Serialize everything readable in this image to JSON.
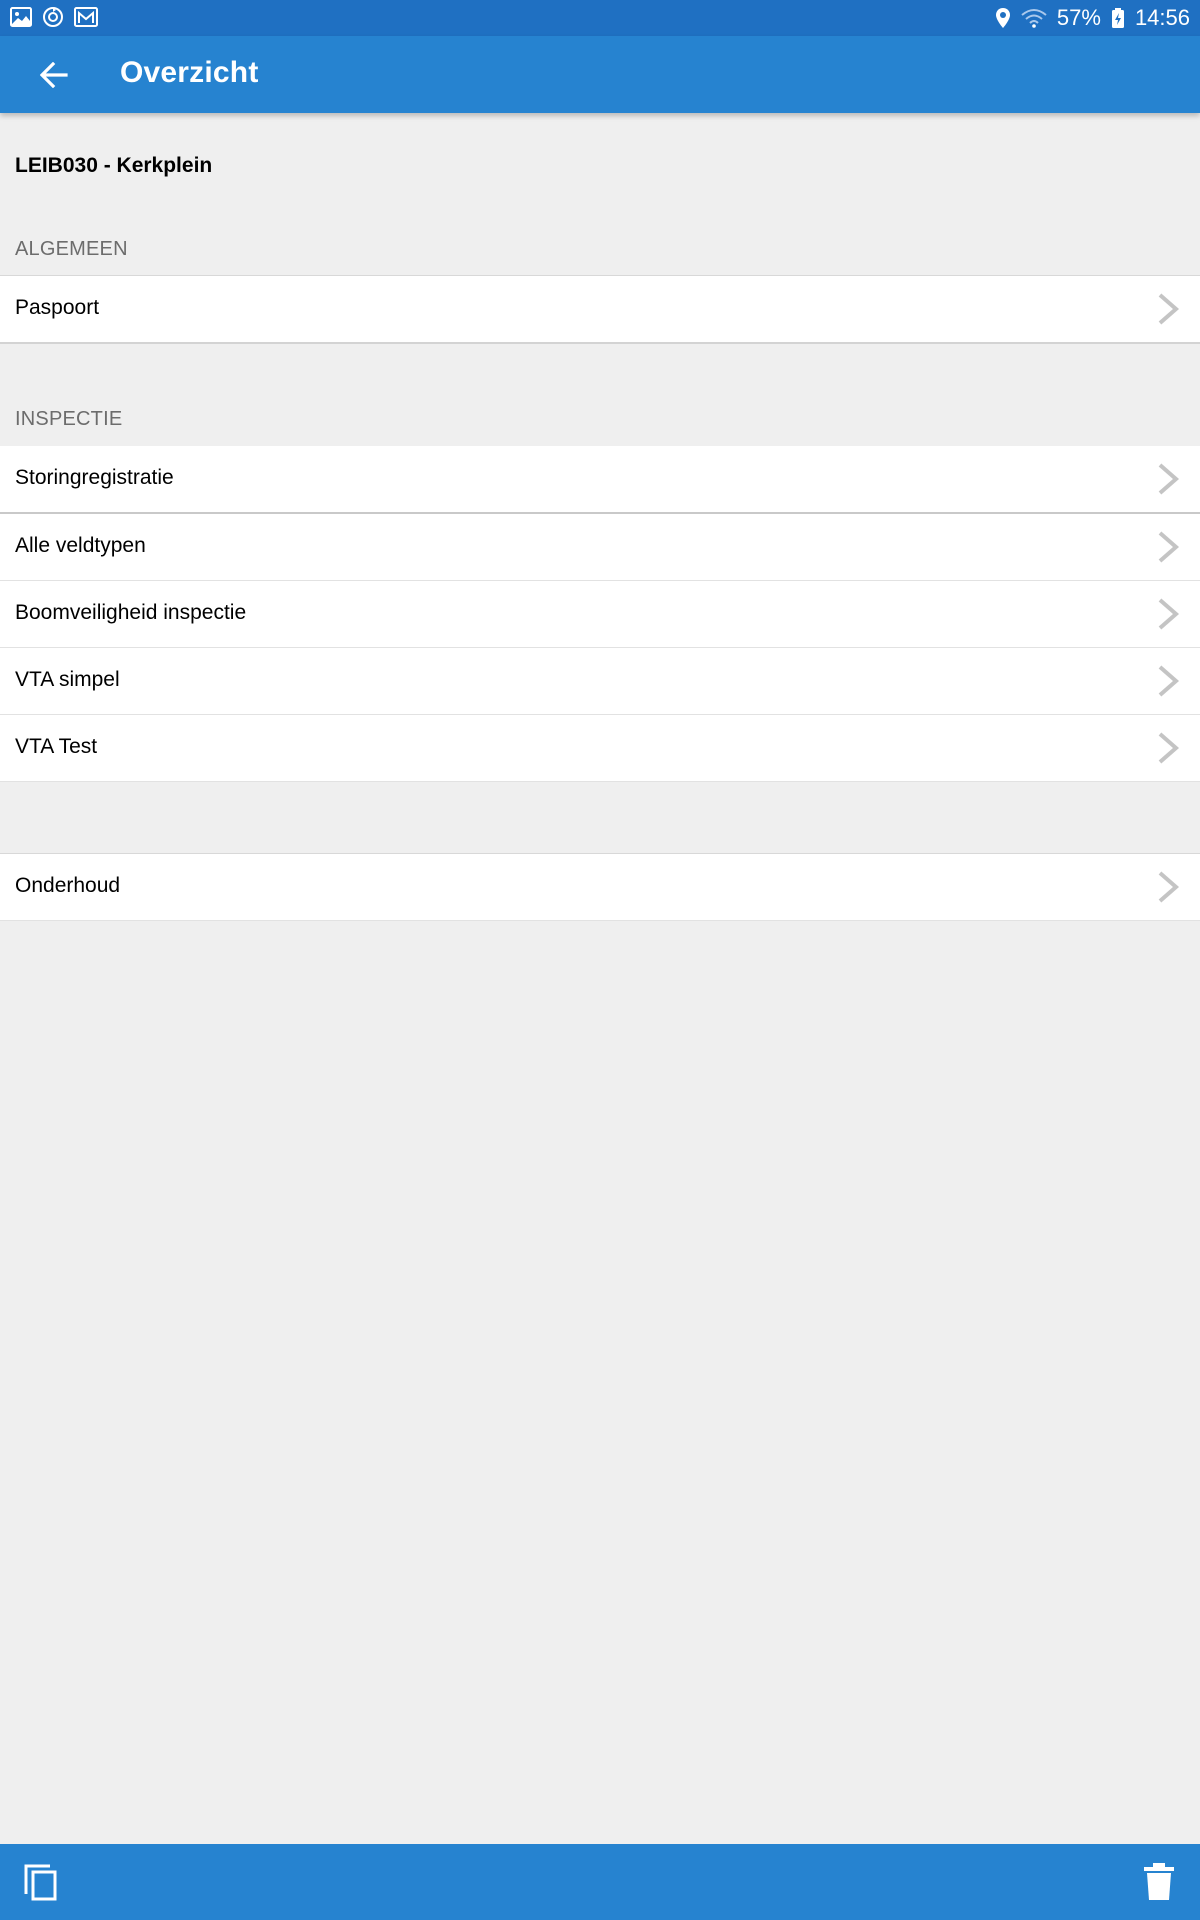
{
  "status_bar": {
    "battery": "57%",
    "time": "14:56"
  },
  "app_bar": {
    "title": "Overzicht"
  },
  "object": {
    "title": "LEIB030 - Kerkplein"
  },
  "sections": {
    "algemeen": {
      "header": "ALGEMEEN",
      "items": [
        "Paspoort"
      ]
    },
    "inspectie": {
      "header": "INSPECTIE",
      "items": [
        "Storingregistratie",
        "Alle veldtypen",
        "Boomveiligheid inspectie",
        "VTA simpel",
        "VTA Test"
      ]
    },
    "overig": {
      "items": [
        "Onderhoud"
      ]
    }
  },
  "icons": {
    "back": "arrow-left-icon",
    "chevron": "chevron-right-icon",
    "copy": "copy-icon",
    "delete": "trash-icon"
  },
  "colors": {
    "status_bar": "#1f70c2",
    "app_bar": "#2683d0",
    "background": "#efefef",
    "section_header": "#6c6c6c",
    "chevron": "#c4c4c4"
  }
}
